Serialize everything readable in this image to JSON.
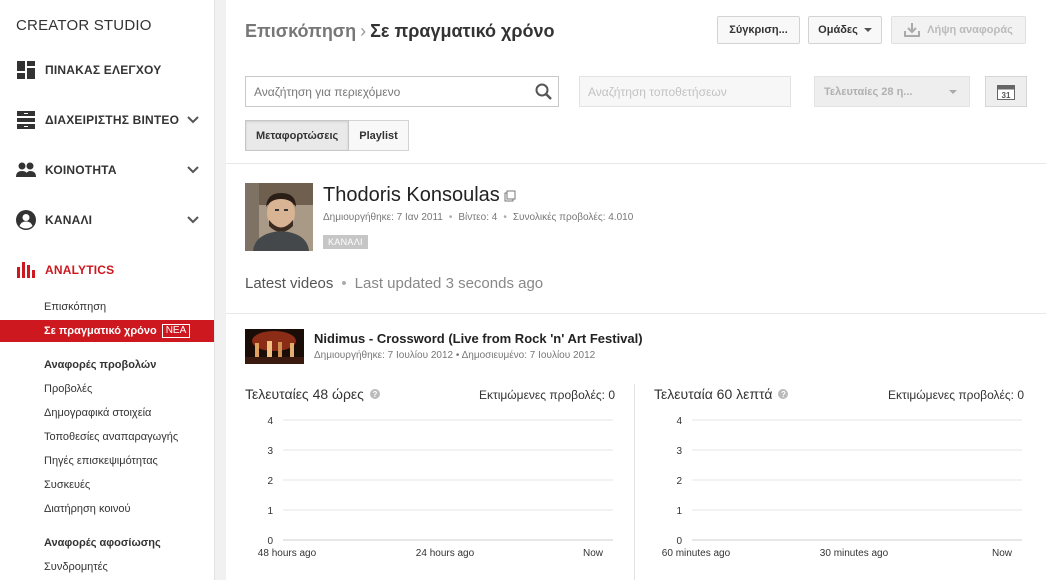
{
  "sidebar": {
    "brand": "CREATOR STUDIO",
    "items": [
      {
        "label": "ΠΙΝΑΚΑΣ ΕΛΕΓΧΟΥ",
        "icon": "dashboard-icon"
      },
      {
        "label": "ΔΙΑΧΕΙΡΙΣΤΗΣ ΒΙΝΤΕΟ",
        "icon": "video-manager-icon"
      },
      {
        "label": "ΚΟΙΝΟΤΗΤΑ",
        "icon": "community-icon"
      },
      {
        "label": "ΚΑΝΑΛΙ",
        "icon": "channel-icon"
      },
      {
        "label": "ANALYTICS",
        "icon": "analytics-icon"
      }
    ],
    "analytics": {
      "overview": "Επισκόπηση",
      "realtime": "Σε πραγματικό χρόνο",
      "new_badge": "ΝΕΑ",
      "views_reports_header": "Αναφορές προβολών",
      "views_reports": [
        "Προβολές",
        "Δημογραφικά στοιχεία",
        "Τοποθεσίες αναπαραγωγής",
        "Πηγές επισκεψιμότητας",
        "Συσκευές",
        "Διατήρηση κοινού"
      ],
      "engagement_header": "Αναφορές αφοσίωσης",
      "engagement_reports": [
        "Συνδρομητές"
      ]
    }
  },
  "header": {
    "breadcrumb_parent": "Επισκόπηση",
    "breadcrumb_separator": "›",
    "breadcrumb_current": "Σε πραγματικό χρόνο",
    "compare_label": "Σύγκριση...",
    "groups_label": "Ομάδες",
    "download_label": "Λήψη αναφοράς"
  },
  "filters": {
    "search_placeholder": "Αναζήτηση για περιεχόμενο",
    "placements_placeholder": "Αναζήτηση τοποθετήσεων",
    "date_range": "Τελευταίες 28 η...",
    "calendar_day": "31"
  },
  "tabs": [
    "Μεταφορτώσεις",
    "Playlist"
  ],
  "channel": {
    "name": "Thodoris Konsoulas",
    "created": "Δημιουργήθηκε: 7 Ιαν 2011",
    "videos": "Βίντεο: 4",
    "views": "Συνολικές προβολές: 4.010",
    "badge": "ΚΑΝΑΛΙ"
  },
  "latest": {
    "label": "Latest videos",
    "separator": "•",
    "updated": "Last updated 3 seconds ago"
  },
  "video": {
    "title": "Nidimus - Crossword (Live from Rock 'n' Art Festival)",
    "meta": "Δημιουργήθηκε: 7 Ιουλίου 2012 • Δημοσιευμένο: 7 Ιουλίου 2012"
  },
  "charts": {
    "left": {
      "heading": "Τελευταίες 48 ώρες",
      "estimated": "Εκτιμώμενες προβολές: 0"
    },
    "right": {
      "heading": "Τελευταία 60 λεπτά",
      "estimated": "Εκτιμώμενες προβολές: 0"
    }
  },
  "chart_data": [
    {
      "type": "bar",
      "x_ticks": [
        "48 hours ago",
        "24 hours ago",
        "Now"
      ],
      "y_ticks": [
        0,
        1,
        2,
        3,
        4
      ],
      "ylim": [
        0,
        4
      ],
      "values": [],
      "grid": true
    },
    {
      "type": "bar",
      "x_ticks": [
        "60 minutes ago",
        "30 minutes ago",
        "Now"
      ],
      "y_ticks": [
        0,
        1,
        2,
        3,
        4
      ],
      "ylim": [
        0,
        4
      ],
      "values": [],
      "grid": true
    }
  ],
  "colors": {
    "accent": "#cc181e",
    "gridline": "#e5e5e5"
  }
}
